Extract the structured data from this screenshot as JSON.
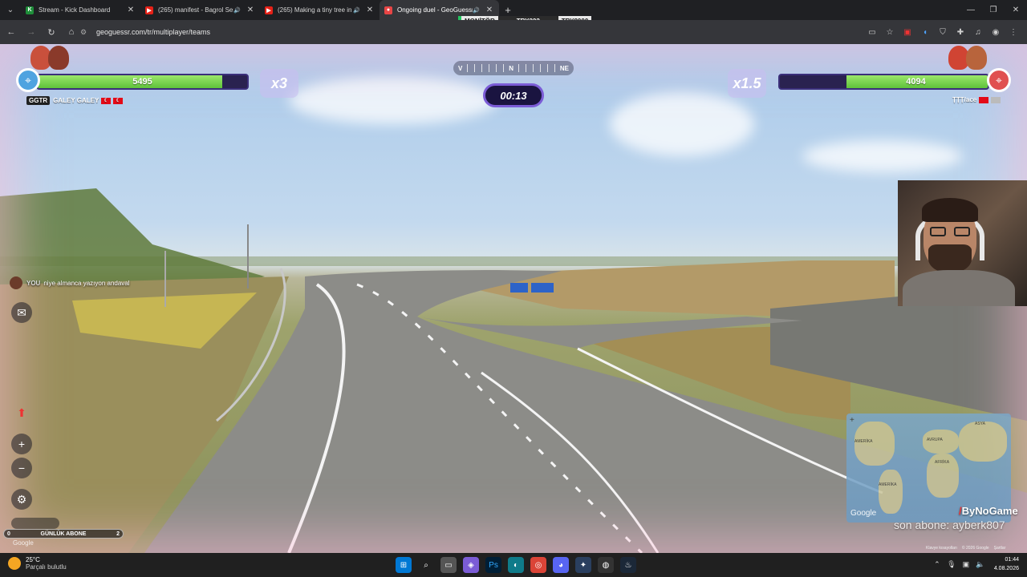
{
  "browser": {
    "tabs": [
      {
        "title": "Stream - Kick Dashboard",
        "fav_color": "#1f8f3a",
        "fav_glyph": "K"
      },
      {
        "title": "(265) manifest - Bagrol Sen",
        "fav_color": "#e62117",
        "fav_glyph": "▶"
      },
      {
        "title": "(265) Making a tiny tree in a th",
        "fav_color": "#e62117",
        "fav_glyph": "▶"
      },
      {
        "title": "Ongoing duel - GeoGuessr",
        "fav_color": "#e84545",
        "fav_glyph": "●"
      }
    ],
    "url": "geoguessr.com/tr/multiplayer/teams"
  },
  "stream_overlay": {
    "labels": [
      {
        "text": "MONİTÖR",
        "bg": "#e8e8e8",
        "fg": "#111111",
        "accent": "#22c55e"
      },
      {
        "text": "TRY222",
        "bg": "#2b2b2b",
        "fg": "#ffffff",
        "accent": ""
      },
      {
        "text": "TRY8000",
        "bg": "#e8e8e8",
        "fg": "#111111",
        "accent": ""
      }
    ]
  },
  "duel": {
    "left_team": {
      "health": "5495",
      "health_fraction": 0.88,
      "multiplier": "x3",
      "badge": "GGTR",
      "name": "GALEY GALEY",
      "color": "#4fa3e0"
    },
    "right_team": {
      "health": "4094",
      "health_fraction": 0.68,
      "multiplier": "x1.5",
      "name": "ȚȚȚ/ace",
      "color": "#e05050"
    },
    "compass": {
      "left": "V",
      "center": "N",
      "right": "NE"
    },
    "timer": "00:13"
  },
  "chat": {
    "sender": "YOU",
    "message": "niye almanca yazıyon andaval"
  },
  "controls": {
    "zoom_in": "+",
    "zoom_out": "−"
  },
  "minimap": {
    "labels": [
      "AMERİKA",
      "AVRUPA",
      "AFRİKA",
      "AMERİKA",
      "ASYA"
    ],
    "google": "Google",
    "attribution": [
      "Klavye kısayolları",
      "© 2026 Google",
      "Şartlar"
    ]
  },
  "stream": {
    "brand": "ByNoGame",
    "latest_sub": "son abone: ayberk807",
    "sub_goal_label": "GÜNLÜK ABONE",
    "sub_goal_current": "0",
    "sub_goal_target": "2"
  },
  "streetview": {
    "google": "Google"
  },
  "taskbar": {
    "weather_temp": "25°C",
    "weather_desc": "Parçalı bulutlu",
    "time": "01:44",
    "date": "4.08.2026"
  }
}
